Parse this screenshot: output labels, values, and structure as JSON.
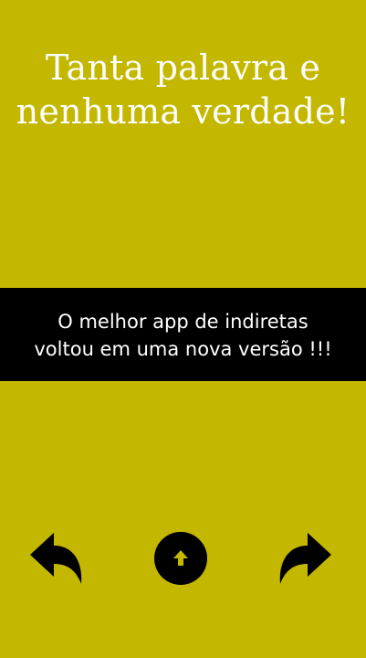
{
  "quote": {
    "text": "Tanta palavra e nenhuma verdade!"
  },
  "banner": {
    "text": "O melhor app de indiretas\nvoltou em uma nova versão !!!"
  },
  "nav": {
    "prev_icon": "curved-arrow-left-icon",
    "home_icon": "up-arrow-circle-icon",
    "next_icon": "curved-arrow-right-icon"
  },
  "colors": {
    "background": "#c4b700",
    "banner_background": "#000000",
    "text": "#ffffff",
    "icon": "#000000"
  }
}
